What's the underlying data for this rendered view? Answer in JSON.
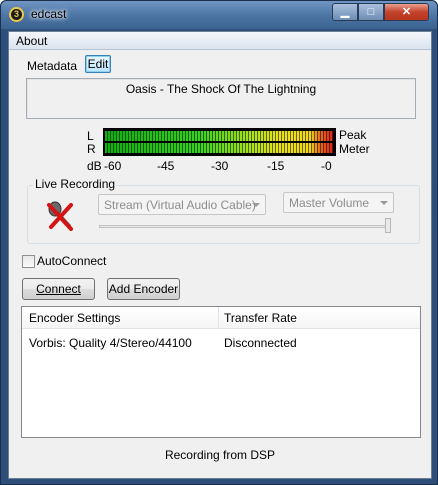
{
  "window": {
    "title": "edcast",
    "icon_letter": "3",
    "min_glyph": "▁",
    "max_glyph": "□",
    "close_glyph": "✕"
  },
  "menu": {
    "about": "About"
  },
  "metadata": {
    "label": "Metadata",
    "edit_button": "Edit",
    "now_playing": "Oasis - The Shock Of The Lightning"
  },
  "vu": {
    "left_label": "L",
    "right_label": "R",
    "peak_label": "Peak",
    "meter_label": "Meter",
    "db_label": "dB",
    "ticks": [
      "-60",
      "-45",
      "-30",
      "-15",
      "-0"
    ],
    "left_level": 1.0,
    "right_level": 1.0
  },
  "live_recording": {
    "title": "Live Recording",
    "device": "Stream (Virtual Audio Cable)",
    "volume_source": "Master Volume",
    "slider_level": 1.0
  },
  "autoconnect": {
    "label": "AutoConnect",
    "checked": false
  },
  "buttons": {
    "connect": "Connect",
    "add_encoder": "Add Encoder"
  },
  "encoders": {
    "columns": [
      "Encoder Settings",
      "Transfer Rate"
    ],
    "rows": [
      {
        "settings": "Vorbis: Quality 4/Stereo/44100",
        "rate": "Disconnected"
      }
    ]
  },
  "status": "Recording from DSP",
  "colors": {
    "accent": "#3c7fb1",
    "vu_green": "#35d020",
    "vu_red": "#e0201c"
  }
}
